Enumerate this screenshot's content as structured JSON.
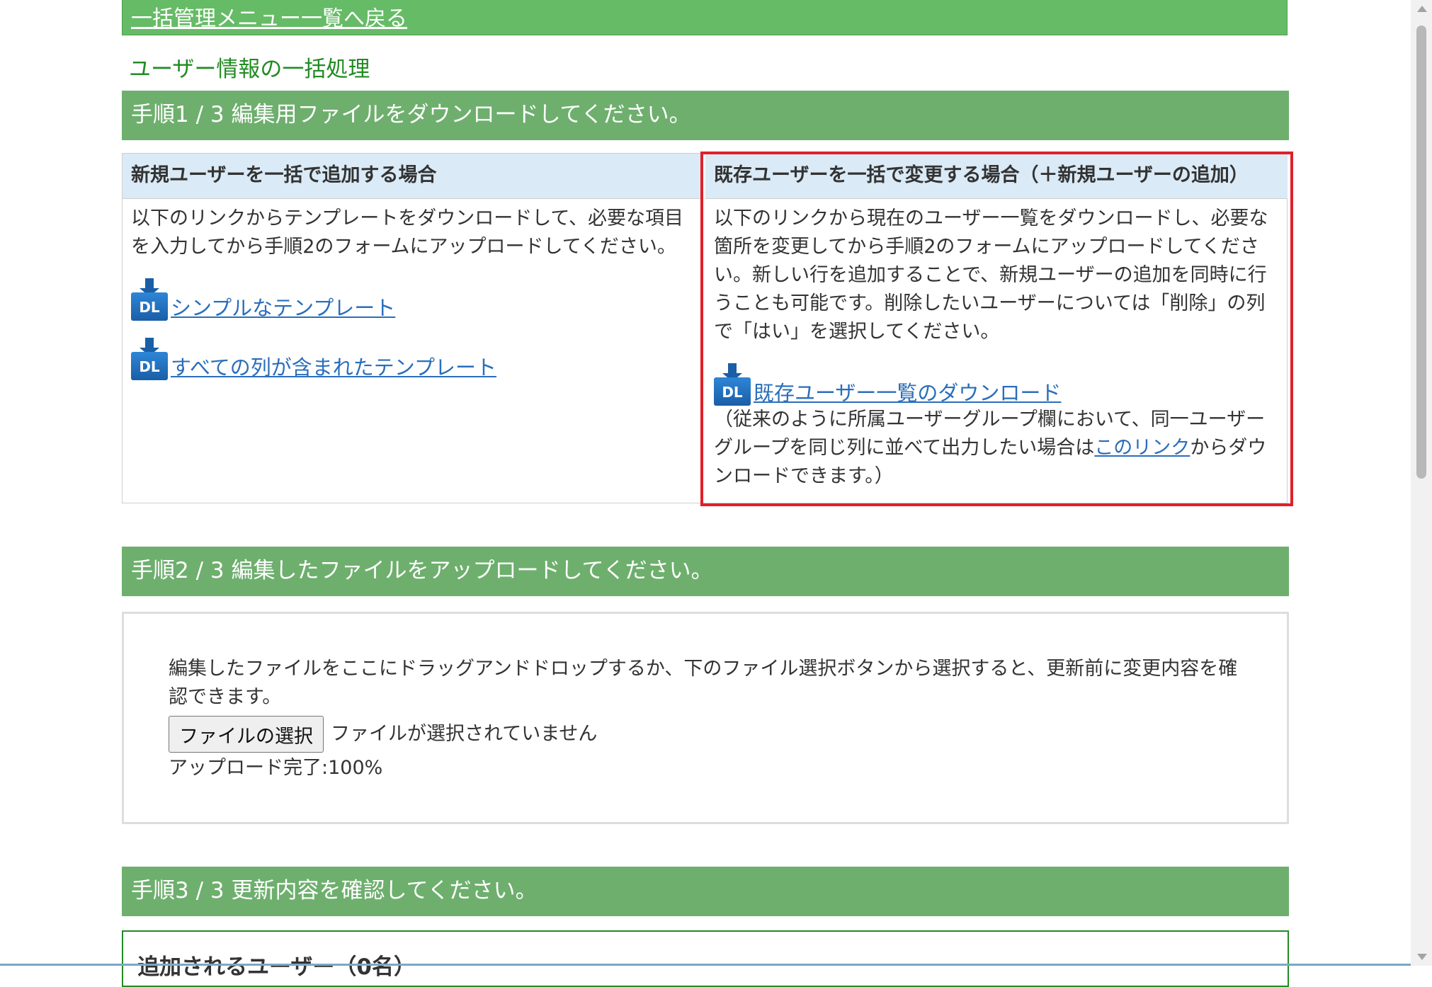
{
  "back_link": "一括管理メニュー一覧へ戻る",
  "page_title": "ユーザー情報の一括処理",
  "step1": {
    "title": "手順1 / 3 編集用ファイルをダウンロードしてください。",
    "new_users": {
      "heading": "新規ユーザーを一括で追加する場合",
      "description": "以下のリンクからテンプレートをダウンロードして、必要な項目を入力してから手順2のフォームにアップロードしてください。",
      "links": [
        "シンプルなテンプレート",
        "すべての列が含まれたテンプレート"
      ],
      "dl_icon_label": "DL"
    },
    "existing_users": {
      "heading": "既存ユーザーを一括で変更する場合（＋新規ユーザーの追加）",
      "description": "以下のリンクから現在のユーザー一覧をダウンロードし、必要な箇所を変更してから手順2のフォームにアップロードしてください。新しい行を追加することで、新規ユーザーの追加を同時に行うことも可能です。削除したいユーザーについては「削除」の列で「はい」を選択してください。",
      "download_link": "既存ユーザー一覧のダウンロード",
      "note_before": "（従来のように所属ユーザーグループ欄において、同一ユーザーグループを同じ列に並べて出力したい場合は",
      "note_link": "このリンク",
      "note_after": "からダウンロードできます。）",
      "dl_icon_label": "DL"
    }
  },
  "step2": {
    "title": "手順2 / 3 編集したファイルをアップロードしてください。",
    "instruction": "編集したファイルをここにドラッグアンドドロップするか、下のファイル選択ボタンから選択すると、更新前に変更内容を確認できます。",
    "file_button": "ファイルの選択",
    "file_status": "ファイルが選択されていません",
    "progress": "アップロード完了:100%"
  },
  "step3": {
    "title": "手順3 / 3 更新内容を確認してください。",
    "added_users_heading": "追加されるユーザー（0名）"
  },
  "colors": {
    "header_green": "#66bb66",
    "step_green": "#6eaf6e",
    "title_green": "#228b22",
    "column_head_blue": "#daeaf6",
    "highlight_red": "#e0202a",
    "link_blue": "#2a6ebb"
  }
}
